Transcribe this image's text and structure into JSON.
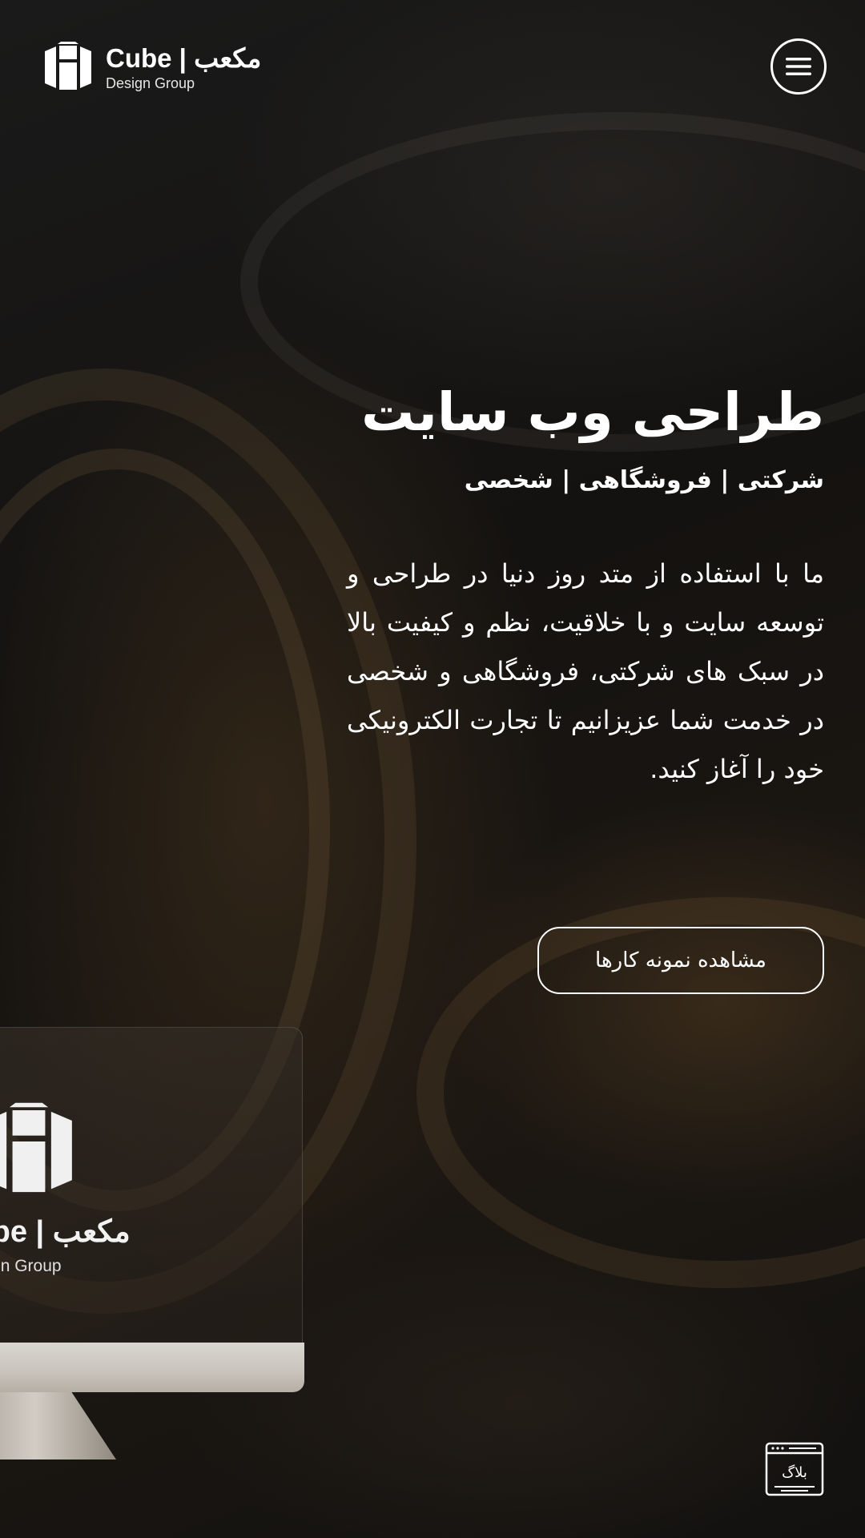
{
  "header": {
    "logo_title": "Cube | مکعب",
    "logo_subtitle": "Design Group"
  },
  "hero": {
    "title": "طراحی وب سایت",
    "subtitle": "شرکتی | فروشگاهی | شخصی",
    "description": "ما با استفاده از متد روز دنیا در طراحی و توسعه سایت و با خلاقیت، نظم و کیفیت بالا در سبک های شرکتی، فروشگاهی و شخصی در خدمت شما عزیزانیم تا تجارت الکترونیکی خود را آغاز کنید.",
    "cta_label": "مشاهده نمونه کارها"
  },
  "monitor": {
    "screen_title": "Cube | مکعب",
    "screen_subtitle": "Design Group"
  },
  "blog": {
    "label": "بلاگ"
  },
  "colors": {
    "background": "#121212",
    "text": "#ffffff",
    "accent_gold": "#6e5537"
  }
}
